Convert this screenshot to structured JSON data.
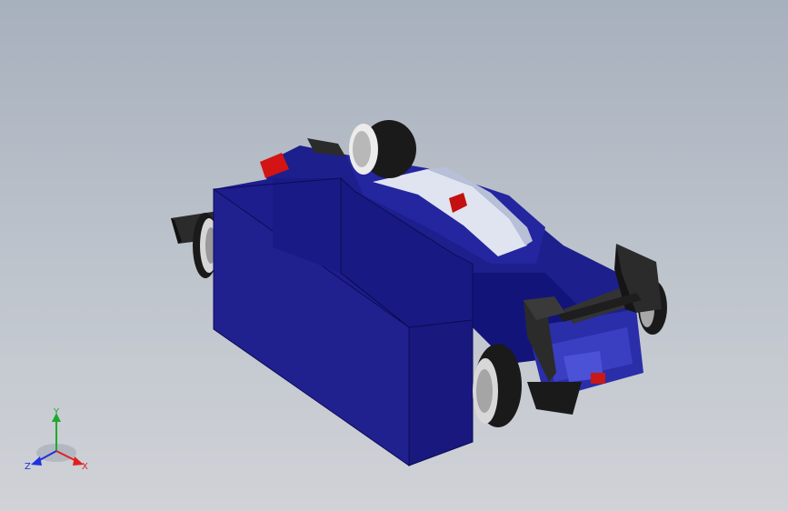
{
  "triad": {
    "x_label": "X",
    "y_label": "Y",
    "z_label": "Z"
  },
  "colors": {
    "background_top": "#a7b0bd",
    "background_bottom": "#d0d2d7",
    "body_blue": "#1c1f8c",
    "body_dark": "#0e1060",
    "accent_red": "#d41414",
    "stripe": "#dfe4f0",
    "tire": "#1a1a1a",
    "wing": "#2b2b2b",
    "axis_x": "#e02020",
    "axis_y": "#1faa2a",
    "axis_z": "#2030e0"
  }
}
